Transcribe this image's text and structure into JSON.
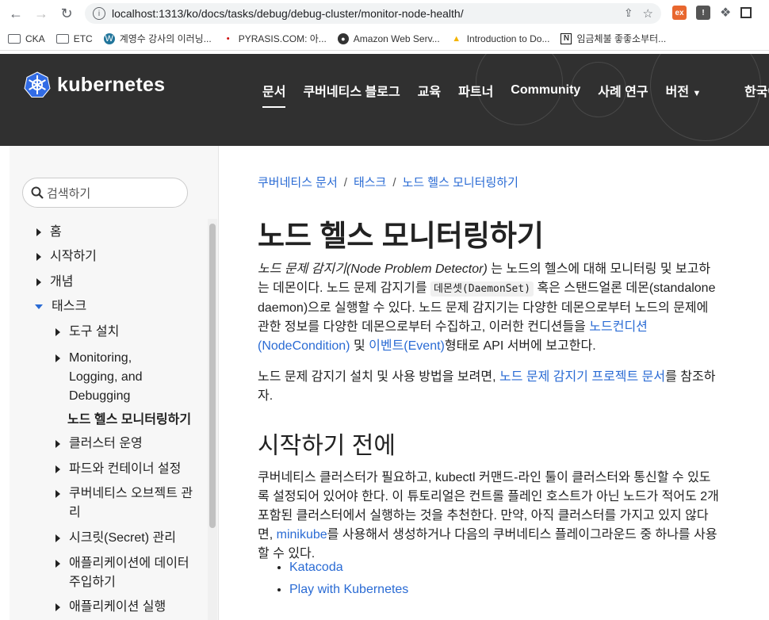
{
  "browser": {
    "url": "localhost:1313/ko/docs/tasks/debug/debug-cluster/monitor-node-health/",
    "bookmarks": [
      {
        "label": "CKA",
        "icon": "folder-icon"
      },
      {
        "label": "ETC",
        "icon": "folder-icon"
      },
      {
        "label": "계영수 강사의 이러닝...",
        "icon": "wordpress-icon"
      },
      {
        "label": "PYRASIS.COM: 아...",
        "icon": "dots-icon"
      },
      {
        "label": "Amazon Web Serv...",
        "icon": "globe-icon"
      },
      {
        "label": "Introduction to Do...",
        "icon": "drive-icon"
      },
      {
        "label": "임금체불 좋좋소부터...",
        "icon": "notion-icon"
      }
    ]
  },
  "header": {
    "logo": "kubernetes",
    "nav": [
      "문서",
      "쿠버네티스 블로그",
      "교육",
      "파트너",
      "Community",
      "사례 연구",
      "버전"
    ],
    "lang": "한국어"
  },
  "sidebar": {
    "search_placeholder": "검색하기",
    "items": [
      {
        "label": "홈"
      },
      {
        "label": "시작하기"
      },
      {
        "label": "개념"
      },
      {
        "label": "태스크"
      },
      {
        "label": "도구 설치"
      },
      {
        "label": "Monitoring,"
      },
      {
        "label": "Logging, and"
      },
      {
        "label": "Debugging"
      },
      {
        "label": "노드 헬스 모니터링하기"
      },
      {
        "label": "클러스터 운영"
      },
      {
        "label": "파드와 컨테이너 설정"
      },
      {
        "label": "쿠버네티스 오브젝트 관"
      },
      {
        "label": "리"
      },
      {
        "label": "시크릿(Secret) 관리"
      },
      {
        "label": "애플리케이션에 데이터"
      },
      {
        "label": "주입하기"
      },
      {
        "label": "애플리케이션 실행"
      }
    ]
  },
  "main": {
    "breadcrumb": [
      "쿠버네티스 문서",
      "태스크",
      "노드 헬스 모니터링하기"
    ],
    "title": "노드 헬스 모니터링하기",
    "intro": {
      "em": "노드 문제 감지기(Node Problem Detector)",
      "t1": " 는 노드의 헬스에 대해 모니터링 및 보고하는 데몬이다. 노드 문제 감지기를 ",
      "code": "데몬셋(DaemonSet)",
      "t2": " 혹은 스탠드얼론 데몬(standalone daemon)으로 실행할 수 있다. 노드 문제 감지기는 다양한 데몬으로부터 노드의 문제에 관한 정보를 다양한 데몬으로부터 수집하고, 이러한 컨디션들을 ",
      "link1": "노드컨디션(NodeCondition)",
      "t3": " 및 ",
      "link2": "이벤트(Event)",
      "t4": "형태로 API 서버에 보고한다."
    },
    "p2": {
      "t1": "노드 문제 감지기 설치 및 사용 방법을 보려면, ",
      "link": "노드 문제 감지기 프로젝트 문서",
      "t2": "를 참조하자."
    },
    "h2": "시작하기 전에",
    "p3": {
      "t1": "쿠버네티스 클러스터가 필요하고, kubectl 커맨드-라인 툴이 클러스터와 통신할 수 있도록 설정되어 있어야 한다. 이 튜토리얼은 컨트롤 플레인 호스트가 아닌 노드가 적어도 2개 포함된 클러스터에서 실행하는 것을 추천한다. 만약, 아직 클러스터를 가지고 있지 않다면, ",
      "link": "minikube",
      "t2": "를 사용해서 생성하거나 다음의 쿠버네티스 플레이그라운드 중 하나를 사용할 수 있다."
    },
    "bullets": [
      "Katacoda",
      "Play with Kubernetes"
    ]
  },
  "colors": {
    "link": "#2a6bd4",
    "header_bg": "#303030",
    "k8s_blue": "#326ce5"
  }
}
